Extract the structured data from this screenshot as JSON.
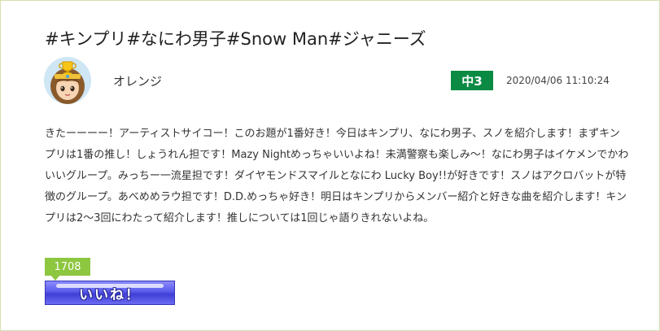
{
  "post": {
    "title": "#キンプリ#なにわ男子#Snow Man#ジャニーズ",
    "author": {
      "name": "オレンジ",
      "grade": "中3",
      "avatar_icon": "avatar-character-icon"
    },
    "timestamp": "2020/04/06 11:10:24",
    "body": "きたーーーー！アーティストサイコー！このお題が1番好き！今日はキンプリ、なにわ男子、スノを紹介します！まずキンプリは1番の推し！しょうれん担です！Mazy Nightめっちゃいいよね！未満警察も楽しみ〜！なにわ男子はイケメンでかわいいグループ。みっちー一流星担です！ダイヤモンドスマイルとなにわ Lucky Boy!!が好きです！スノはアクロバットが特徴のグループ。あべめめラウ担です！D.D.めっちゃ好き！明日はキンプリからメンバー紹介と好きな曲を紹介します！キンプリは2〜3回にわたって紹介します！推しについては1回じゃ語りきれないよね。",
    "likes": {
      "count": "1708",
      "button_label": "いいね！"
    }
  },
  "colors": {
    "grade_badge": "#0a8a43",
    "like_count_bg": "#8dc63f",
    "like_button": "#5b5bea",
    "card_border": "#d6e0b0"
  }
}
